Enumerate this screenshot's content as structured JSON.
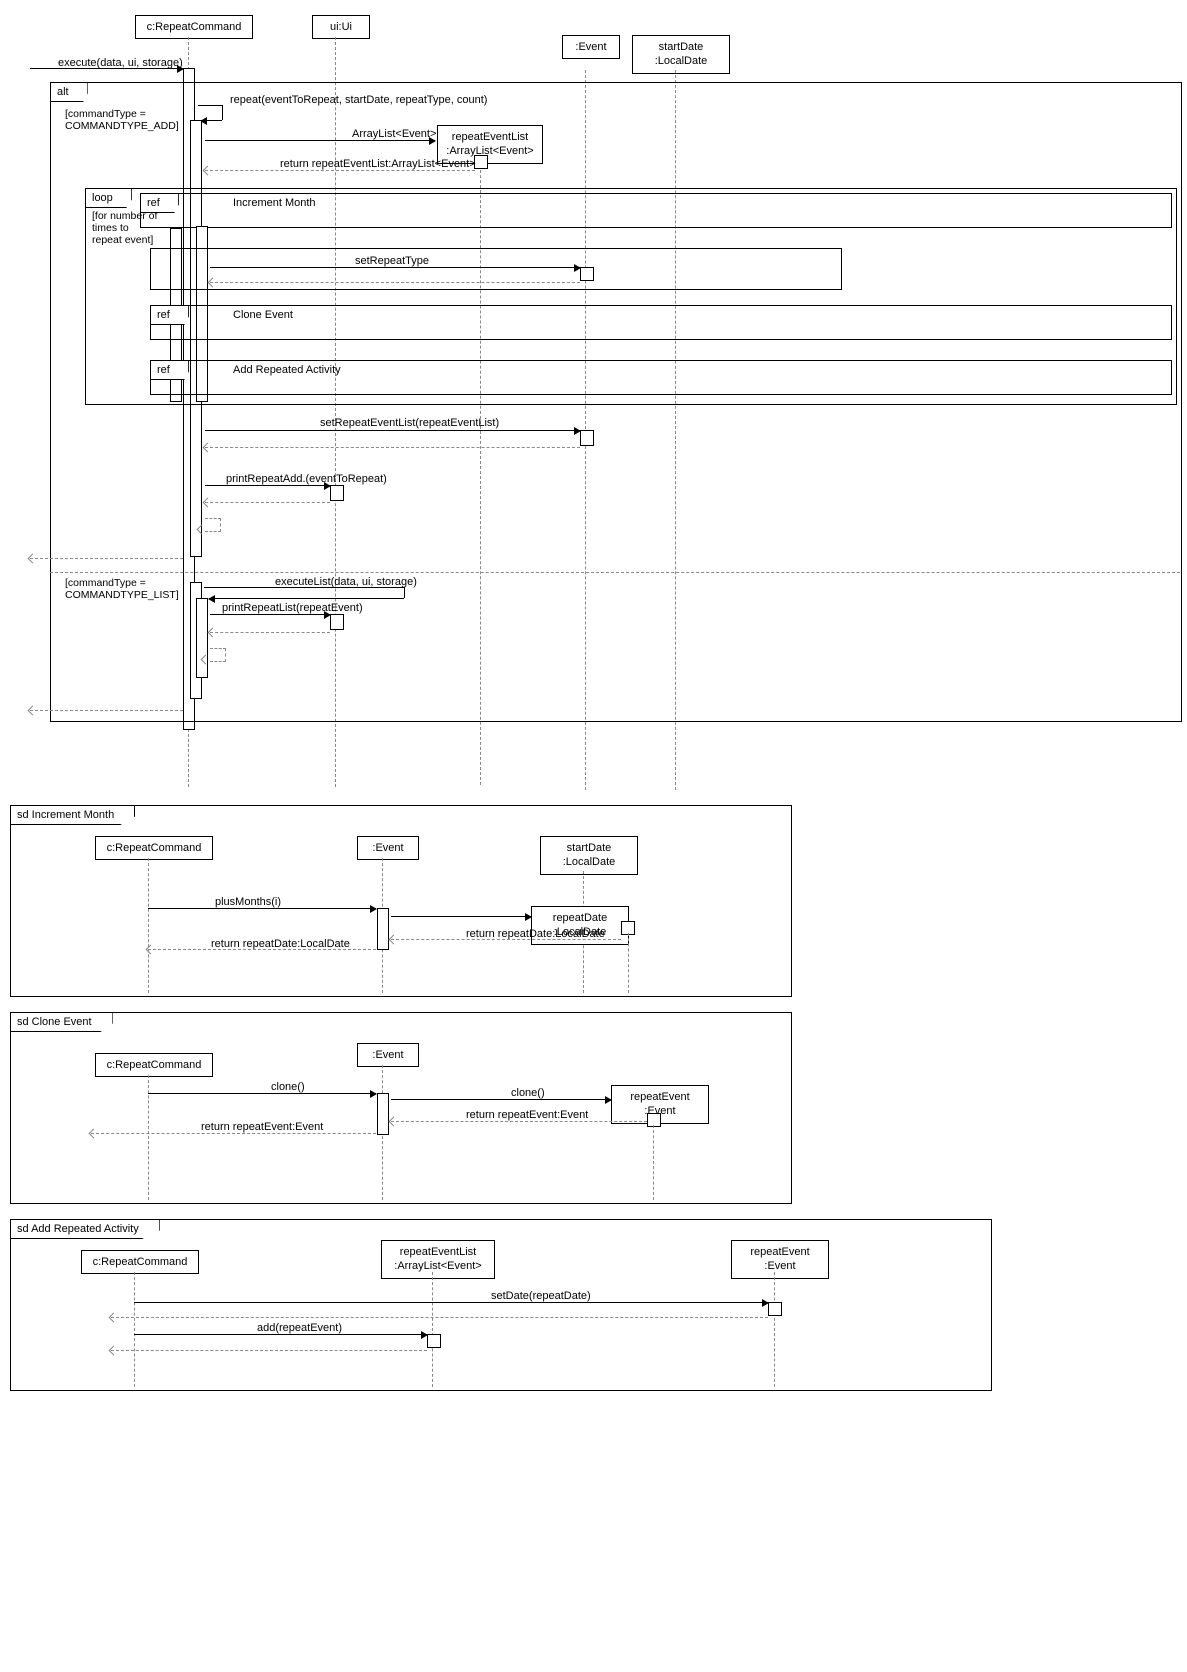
{
  "main": {
    "participants": {
      "repeatCmd": "c:RepeatCommand",
      "ui": "ui:Ui",
      "event": ":Event",
      "startDate": "startDate\n:LocalDate"
    },
    "messages": {
      "execute": "execute(data, ui, storage)",
      "repeat": "repeat(eventToRepeat, startDate, repeatType, count)",
      "arrayListCtor": "ArrayList<Event>()",
      "repeatEventList": "repeatEventList\n:ArrayList<Event>",
      "returnRepeatEventList": "return repeatEventList:ArrayList<Event>",
      "setRepeatType": "setRepeatType",
      "setRepeatEventList": "setRepeatEventList(repeatEventList)",
      "printRepeatAdd": "printRepeatAdd.(eventToRepeat)",
      "executeList": "executeList(data, ui, storage)",
      "printRepeatList": "printRepeatList(repeatEvent)"
    },
    "frames": {
      "alt": "alt",
      "loop": "loop",
      "ref": "ref",
      "incrementMonth": "Increment Month",
      "cloneEvent": "Clone Event",
      "addRepeatedActivity": "Add Repeated Activity"
    },
    "guards": {
      "add": "[commandType =\nCOMMANDTYPE_ADD]",
      "list": "[commandType =\nCOMMANDTYPE_LIST]",
      "loop": "[for number of\ntimes to\nrepeat event]"
    }
  },
  "sd1": {
    "title": "sd Increment Month",
    "participants": {
      "repeatCmd": "c:RepeatCommand",
      "event": ":Event",
      "startDate": "startDate\n:LocalDate",
      "repeatDate": "repeatDate\n:LocalDate"
    },
    "messages": {
      "plusMonths": "plusMonths(i)",
      "returnRepeatDate": "return repeatDate:LocalDate"
    }
  },
  "sd2": {
    "title": "sd Clone Event",
    "participants": {
      "repeatCmd": "c:RepeatCommand",
      "event": ":Event",
      "repeatEvent": "repeatEvent\n:Event"
    },
    "messages": {
      "clone": "clone()",
      "returnRepeatEvent": "return repeatEvent:Event"
    }
  },
  "sd3": {
    "title": "sd Add Repeated Activity",
    "participants": {
      "repeatCmd": "c:RepeatCommand",
      "repeatEventList": "repeatEventList\n:ArrayList<Event>",
      "repeatEvent": "repeatEvent\n:Event"
    },
    "messages": {
      "setDate": "setDate(repeatDate)",
      "add": "add(repeatEvent)"
    }
  }
}
